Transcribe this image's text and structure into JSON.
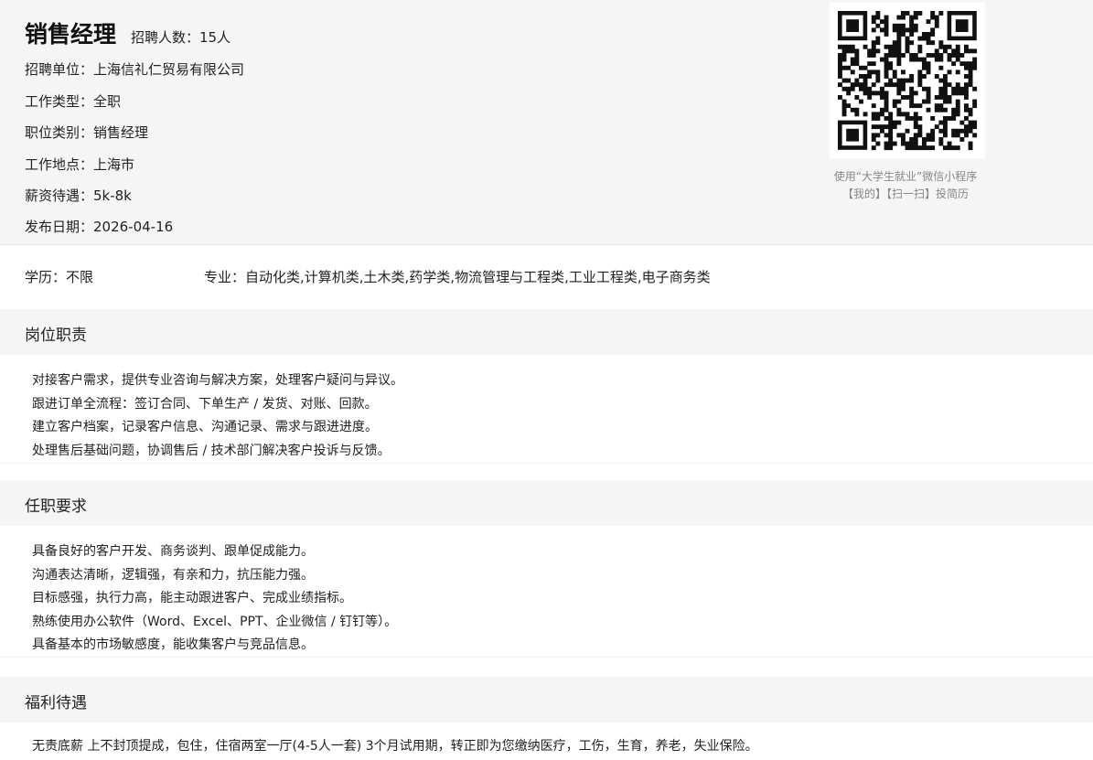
{
  "job": {
    "title": "销售经理",
    "hire_count": "招聘人数：15人"
  },
  "info": [
    "招聘单位：上海信礼仁贸易有限公司",
    "工作类型：全职",
    "职位类别：销售经理",
    "工作地点：上海市",
    "薪资待遇：5k-8k",
    "发布日期：2026-04-16"
  ],
  "qr": {
    "caption_line1": "使用“大学生就业”微信小程序",
    "caption_line2": "【我的】【扫一扫】投简历"
  },
  "requirements": {
    "education": "学历：不限",
    "major": "专业：自动化类,计算机类,土木类,药学类,物流管理与工程类,工业工程类,电子商务类"
  },
  "sections": {
    "duties": {
      "title": "岗位职责",
      "lines": [
        "对接客户需求，提供专业咨询与解决方案，处理客户疑问与异议。",
        "跟进订单全流程：签订合同、下单生产 / 发货、对账、回款。",
        "建立客户档案，记录客户信息、沟通记录、需求与跟进进度。",
        "处理售后基础问题，协调售后 / 技术部门解决客户投诉与反馈。"
      ]
    },
    "qualifications": {
      "title": "任职要求",
      "lines": [
        "具备良好的客户开发、商务谈判、跟单促成能力。",
        "沟通表达清晰，逻辑强，有亲和力，抗压能力强。",
        "目标感强，执行力高，能主动跟进客户、完成业绩指标。",
        "熟练使用办公软件（Word、Excel、PPT、企业微信 / 钉钉等）。",
        "具备基本的市场敏感度，能收集客户与竞品信息。"
      ]
    },
    "benefits": {
      "title": "福利待遇",
      "lines": [
        "无责底薪 上不封顶提成，包住，住宿两室一厅(4-5人一套)  3个月试用期，转正即为您缴纳医疗，工伤，生育，养老，失业保险。"
      ]
    }
  }
}
